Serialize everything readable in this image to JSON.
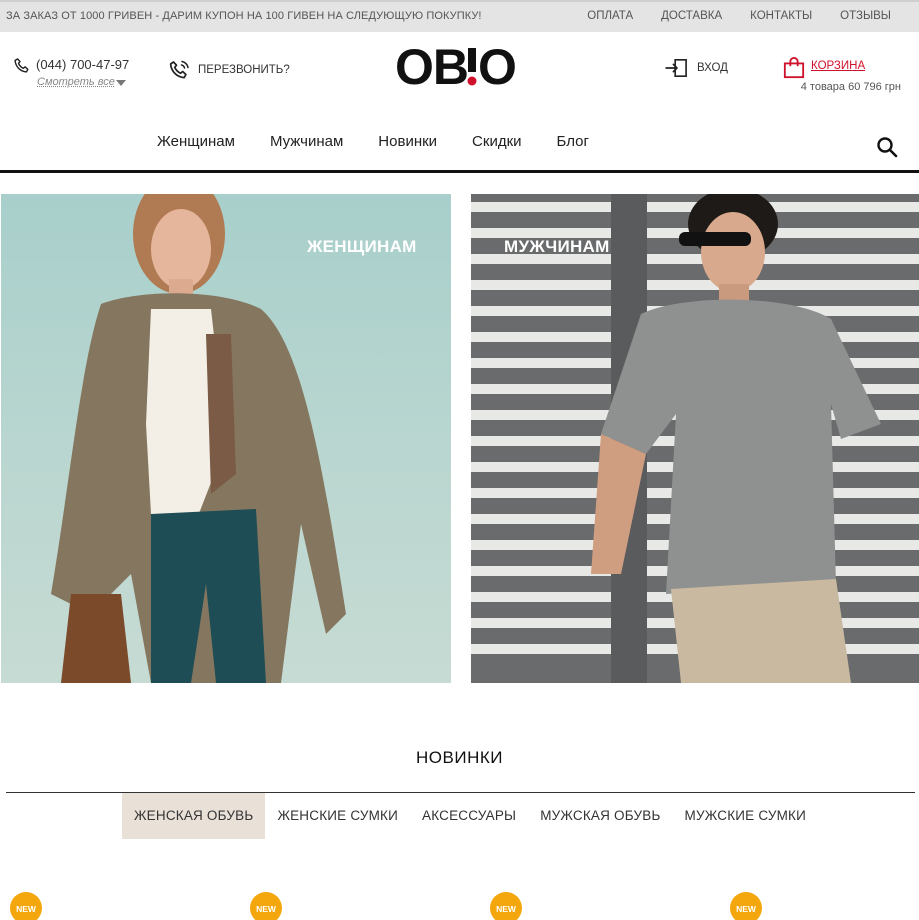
{
  "topbar": {
    "promo": "ЗА ЗАКАЗ ОТ 1000 ГРИВЕН - ДАРИМ КУПОН НА 100 ГИВЕН НА СЛЕДУЮЩУЮ ПОКУПКУ!",
    "links": [
      "ОПЛАТА",
      "ДОСТАВКА",
      "КОНТАКТЫ",
      "ОТЗЫВЫ"
    ]
  },
  "header": {
    "phone": "(044) 700-47-97",
    "see_all": "Смотреть все",
    "callback": "ПЕРЕЗВОНИТЬ?",
    "logo": "OB!O",
    "login": "ВХОД",
    "cart_label": "КОРЗИНА",
    "cart_summary": "4 товара 60 796 грн"
  },
  "nav": {
    "items": [
      "Женщинам",
      "Мужчинам",
      "Новинки",
      "Скидки",
      "Блог"
    ]
  },
  "banners": {
    "women": "ЖЕНЩИНАМ",
    "men": "МУЖЧИНАМ"
  },
  "new_arrivals": {
    "title": "НОВИНКИ",
    "tabs": [
      "ЖЕНСКАЯ ОБУВЬ",
      "ЖЕНСКИЕ СУМКИ",
      "АКСЕССУАРЫ",
      "МУЖСКАЯ ОБУВЬ",
      "МУЖСКИЕ СУМКИ"
    ],
    "badge": "NEW"
  },
  "colors": {
    "accent": "#d0112b",
    "badge": "#f3a70d",
    "active_tab": "#e9e0d8"
  }
}
